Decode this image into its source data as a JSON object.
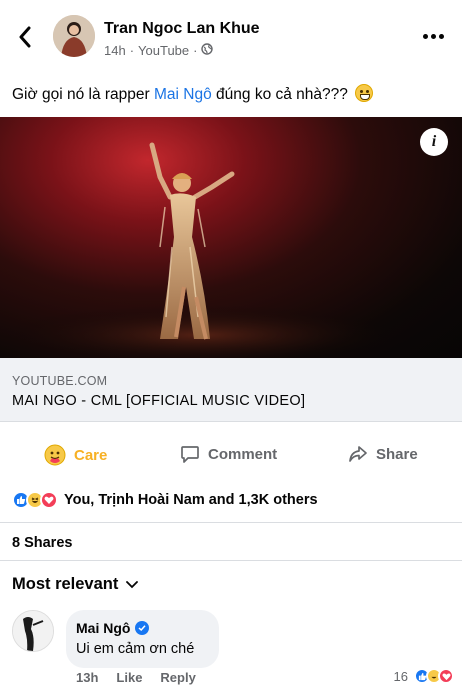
{
  "post": {
    "author": "Tran Ngoc Lan Khue",
    "time": "14h",
    "source": "YouTube",
    "text_before": "Giờ gọi nó là rapper ",
    "mention": "Mai Ngô",
    "text_after": " đúng ko cả nhà???"
  },
  "link_card": {
    "domain": "YOUTUBE.COM",
    "title": "MAI NGO - CML [OFFICIAL MUSIC VIDEO]"
  },
  "actions": {
    "care_label": "Care",
    "comment_label": "Comment",
    "share_label": "Share"
  },
  "reactions": {
    "summary": "You, Trịnh Hoài Nam and 1,3K others",
    "types": [
      "like",
      "haha",
      "love"
    ]
  },
  "shares": "8 Shares",
  "comments": {
    "filter_label": "Most relevant",
    "items": [
      {
        "author": "Mai Ngô",
        "verified": true,
        "text": "Ui em cảm ơn ché",
        "time": "13h",
        "like_label": "Like",
        "reply_label": "Reply",
        "reaction_count": "16"
      }
    ]
  },
  "colors": {
    "accent": "#1877f2",
    "care": "#f7b125",
    "secondary_text": "#65676b"
  }
}
